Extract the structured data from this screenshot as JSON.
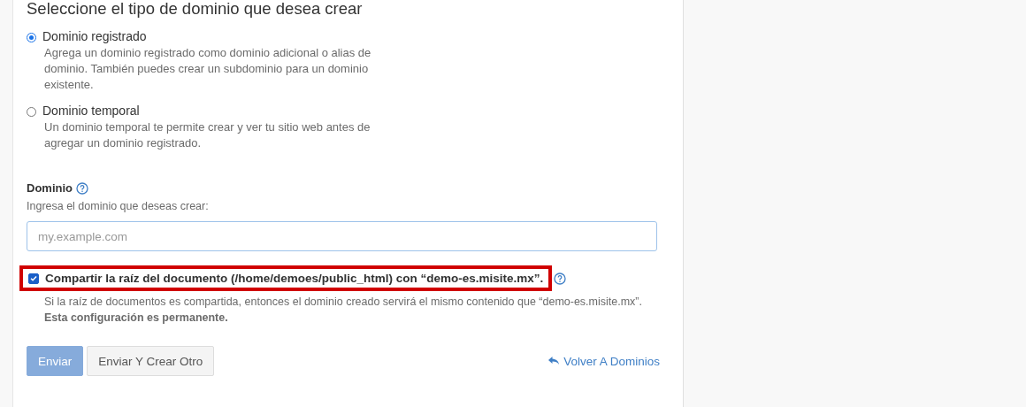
{
  "heading": "Seleccione el tipo de dominio que desea crear",
  "domain_types": [
    {
      "label": "Dominio registrado",
      "description": "Agrega un dominio registrado como dominio adicional o alias de dominio. También puedes crear un subdominio para un dominio existente.",
      "selected": true
    },
    {
      "label": "Dominio temporal",
      "description": "Un dominio temporal te permite crear y ver tu sitio web antes de agregar un dominio registrado.",
      "selected": false
    }
  ],
  "domain_field": {
    "label": "Dominio",
    "hint": "Ingresa el dominio que deseas crear:",
    "placeholder": "my.example.com"
  },
  "share_root": {
    "label": "Compartir la raíz del documento (/home/demoes/public_html) con “demo-es.misite.mx”.",
    "checked": true,
    "highlighted": true,
    "description": "Si la raíz de documentos es compartida, entonces el dominio creado servirá el mismo contenido que “demo-es.misite.mx”. **Esta configuración es permanente.**"
  },
  "buttons": [
    {
      "label": "Enviar",
      "kind": "primary"
    },
    {
      "label": "Enviar Y Crear Otro",
      "kind": "secondary"
    }
  ],
  "back_link": "Volver A Dominios"
}
